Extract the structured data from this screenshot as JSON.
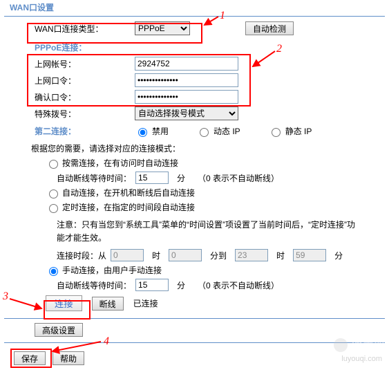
{
  "title": "WAN口设置",
  "wan": {
    "label": "WAN口连接类型：",
    "value": "PPPoE",
    "detect_btn": "自动检测"
  },
  "pppoe": {
    "header": "PPPoE连接：",
    "account_label": "上网帐号：",
    "account_value": "2924752",
    "password_label": "上网口令：",
    "password_value": "••••••••••••••",
    "confirm_label": "确认口令：",
    "confirm_value": "••••••••••••••",
    "dial_label": "特殊拨号：",
    "dial_value": "自动选择拨号模式"
  },
  "second_conn": {
    "label": "第二连接：",
    "opt_disable": "禁用",
    "opt_dynamic": "动态 IP",
    "opt_static": "静态 IP"
  },
  "mode": {
    "prompt": "根据您的需要，请选择对应的连接模式：",
    "on_demand": "按需连接，在有访问时自动连接",
    "on_demand_wait_label": "自动断线等待时间：",
    "on_demand_wait_value": "15",
    "on_demand_wait_unit": "分",
    "on_demand_wait_hint": "（0 表示不自动断线）",
    "auto": "自动连接，在开机和断线后自动连接",
    "timed": "定时连接，在指定的时间段自动连接",
    "timed_note": "注意：只有当您到“系统工具”菜单的“时间设置”项设置了当前时间后，“定时连接”功能才能生效。",
    "period_label": "连接时段：从",
    "period_from_h": "0",
    "hour_unit": "时",
    "period_from_m": "0",
    "min_unit": "分到",
    "period_to_h": "23",
    "period_to_m": "59",
    "min_unit2": "分",
    "manual": "手动连接，由用户手动连接",
    "manual_wait_label": "自动断线等待时间：",
    "manual_wait_value": "15",
    "manual_wait_unit": "分",
    "manual_wait_hint": "（0 表示不自动断线）",
    "connect_btn": "连接",
    "disconnect_btn": "断线",
    "status": "已连接"
  },
  "advanced_btn": "高级设置",
  "save_btn": "保存",
  "help_btn": "帮助",
  "annot": {
    "n1": "1",
    "n2": "2",
    "n3": "3",
    "n4": "4"
  },
  "watermark": {
    "text": "路由器",
    "sub": "luyouqi.com"
  }
}
